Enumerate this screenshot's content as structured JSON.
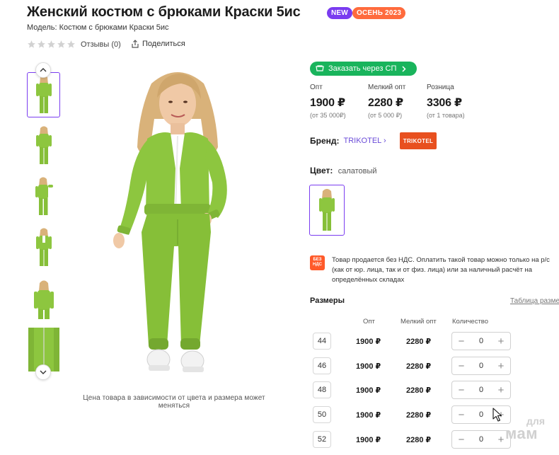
{
  "product": {
    "title": "Женский костюм с брюками Краски 5ис",
    "badges": {
      "new": "NEW",
      "season": "ОСЕНЬ 2023"
    },
    "model": "Модель: Костюм с брюками Краски 5ис",
    "rating_stars": 0,
    "reviews": "Отзывы (0)",
    "share": "Поделиться"
  },
  "gallery": {
    "thumbnail_count": 6,
    "active_index": 0,
    "caption": "Цена товара в зависимости от цвета и размера может меняться"
  },
  "order": {
    "sp_button": "Заказать через СП"
  },
  "prices": [
    {
      "label": "Опт",
      "value": "1900 ₽",
      "note": "(от 35 000₽)"
    },
    {
      "label": "Мелкий опт",
      "value": "2280 ₽",
      "note": "(от 5 000 ₽)"
    },
    {
      "label": "Розница",
      "value": "3306 ₽",
      "note": "(от 1 товара)"
    }
  ],
  "brand": {
    "label": "Бренд:",
    "value": "TRIKOTEL",
    "logo_text": "TRIKOTEL"
  },
  "color": {
    "label": "Цвет:",
    "value": "салатовый"
  },
  "tax": {
    "icon_text": "БЕЗ НДС",
    "text": "Товар продается без НДС. Оплатить такой товар можно только на р/с (как от юр. лица, так и от физ. лица) или за наличный расчёт на определённых складах"
  },
  "sizes": {
    "title": "Размеры",
    "table_link": "Таблица разме",
    "headers": {
      "opt": "Опт",
      "small_opt": "Мелкий опт",
      "quantity": "Количество"
    },
    "rows": [
      {
        "size": "44",
        "opt": "1900 ₽",
        "small_opt": "2280 ₽",
        "qty": "0"
      },
      {
        "size": "46",
        "opt": "1900 ₽",
        "small_opt": "2280 ₽",
        "qty": "0"
      },
      {
        "size": "48",
        "opt": "1900 ₽",
        "small_opt": "2280 ₽",
        "qty": "0"
      },
      {
        "size": "50",
        "opt": "1900 ₽",
        "small_opt": "2280 ₽",
        "qty": "0"
      },
      {
        "size": "52",
        "opt": "1900 ₽",
        "small_opt": "2280 ₽",
        "qty": "0"
      }
    ]
  },
  "watermark": {
    "line1": "для",
    "line2": "мам"
  },
  "colors": {
    "accent": "#7a3cf0",
    "green": "#19b45c",
    "orange": "#ff6b3d",
    "brand": "#e8501f",
    "suit": "#8dc63f"
  }
}
